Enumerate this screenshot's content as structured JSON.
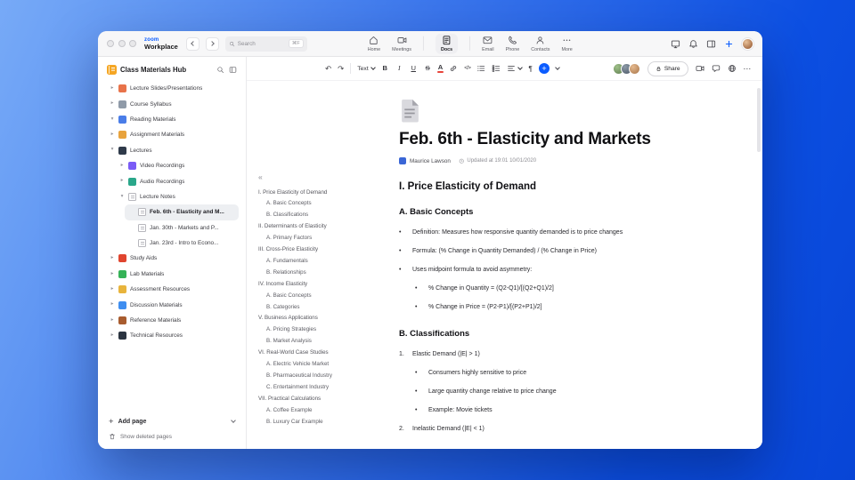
{
  "colors": {
    "accent": "#0b5cff"
  },
  "glyphs": {
    "undo": "↶",
    "redo": "↷",
    "ellipsis": "⋯",
    "collapse": "«",
    "plus": "+",
    "bullet": "•",
    "paragraph": "¶",
    "code": "</>",
    "bold": "B",
    "italic": "I",
    "underline": "U",
    "strike": "S",
    "color_letter": "A"
  },
  "window": {
    "logo": {
      "zoom": "zoom",
      "workplace": "Workplace"
    },
    "search": {
      "placeholder": "Search",
      "shortcut": "⌘F"
    },
    "tabs": [
      {
        "label": "Home"
      },
      {
        "label": "Meetings"
      },
      {
        "label": "Docs"
      },
      {
        "label": "Email"
      },
      {
        "label": "Phone"
      },
      {
        "label": "Contacts"
      },
      {
        "label": "More"
      }
    ],
    "active_tab": "Docs"
  },
  "sidebar": {
    "title": "Class Materials Hub",
    "items": [
      {
        "label": "Lecture Slides/Presentations",
        "chev": "▸"
      },
      {
        "label": "Course Syllabus",
        "chev": "▸"
      },
      {
        "label": "Reading Materials",
        "chev": "▾"
      },
      {
        "label": "Assignment Materials",
        "chev": "▸"
      },
      {
        "label": "Lectures",
        "chev": "▾"
      },
      {
        "label": "Video Recordings",
        "chev": "▸"
      },
      {
        "label": "Audio Recordings",
        "chev": "▸"
      },
      {
        "label": "Lecture Notes",
        "chev": "▾"
      },
      {
        "label": "Feb. 6th - Elasticity and M...",
        "chev": ""
      },
      {
        "label": "Jan. 30th - Markets and P...",
        "chev": ""
      },
      {
        "label": "Jan. 23rd - Intro to Econo...",
        "chev": ""
      },
      {
        "label": "Study Aids",
        "chev": "▸"
      },
      {
        "label": "Lab Materials",
        "chev": "▸"
      },
      {
        "label": "Assessment Resources",
        "chev": "▸"
      },
      {
        "label": "Discussion Materials",
        "chev": "▸"
      },
      {
        "label": "Reference Materials",
        "chev": "▸"
      },
      {
        "label": "Technical Resources",
        "chev": "▸"
      }
    ],
    "add_page_label": "Add page",
    "show_deleted_label": "Show deleted pages"
  },
  "toolbar": {
    "text_style": "Text",
    "share_label": "Share"
  },
  "doc": {
    "title": "Feb. 6th - Elasticity and Markets",
    "author": "Maurice Lawson",
    "updated_text": "Updated at 19:01 10/01/2020",
    "toc": [
      {
        "label": "I. Price Elasticity of Demand"
      },
      {
        "label": "A. Basic Concepts"
      },
      {
        "label": "B. Classifications"
      },
      {
        "label": "II. Determinants of Elasticity"
      },
      {
        "label": "A. Primary Factors"
      },
      {
        "label": "III. Cross-Price Elasticity"
      },
      {
        "label": "A. Fundamentals"
      },
      {
        "label": "B. Relationships"
      },
      {
        "label": "IV. Income Elasticity"
      },
      {
        "label": "A. Basic Concepts"
      },
      {
        "label": "B. Categories"
      },
      {
        "label": "V. Business Applications"
      },
      {
        "label": "A. Pricing Strategies"
      },
      {
        "label": "B. Market Analysis"
      },
      {
        "label": "VI. Real-World Case Studies"
      },
      {
        "label": "A. Electric Vehicle Market"
      },
      {
        "label": "B. Pharmaceutical Industry"
      },
      {
        "label": "C. Entertainment Industry"
      },
      {
        "label": "VII. Practical Calculations"
      },
      {
        "label": "A. Coffee Example"
      },
      {
        "label": "B. Luxury Car Example"
      }
    ],
    "content": {
      "s1": "I. Price Elasticity of Demand",
      "a": "A. Basic Concepts",
      "bullets": [
        "Definition: Measures how responsive quantity demanded is to price changes",
        "Formula: (% Change in Quantity Demanded) / (% Change in Price)",
        "Uses midpoint formula to avoid asymmetry:"
      ],
      "formulas": [
        "% Change in Quantity = (Q2-Q1)/[(Q2+Q1)/2]",
        "% Change in Price = (P2-P1)/[(P2+P1)/2]"
      ],
      "b": "B. Classifications",
      "n1_num": "1.",
      "n1": "Elastic Demand (|E| > 1)",
      "n1_bullets": [
        "Consumers highly sensitive to price",
        "Large quantity change relative to price change",
        "Example: Movie tickets"
      ],
      "n2_num": "2.",
      "n2": "Inelastic Demand (|E| < 1)"
    }
  }
}
